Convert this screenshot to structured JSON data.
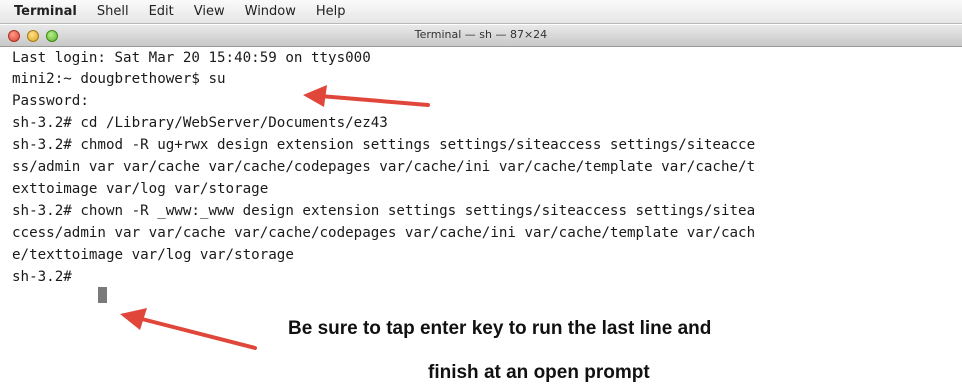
{
  "menubar": {
    "items": [
      "Terminal",
      "Shell",
      "Edit",
      "View",
      "Window",
      "Help"
    ]
  },
  "window": {
    "title": "Terminal — sh — 87×24"
  },
  "terminal": {
    "lines": [
      "Last login: Sat Mar 20 15:40:59 on ttys000",
      "mini2:~ dougbrethower$ su",
      "Password:",
      "sh-3.2# cd /Library/WebServer/Documents/ez43",
      "sh-3.2# chmod -R ug+rwx design extension settings settings/siteaccess settings/siteacce",
      "ss/admin var var/cache var/cache/codepages var/cache/ini var/cache/template var/cache/t",
      "exttoimage var/log var/storage",
      "sh-3.2# chown -R _www:_www design extension settings settings/siteaccess settings/sitea",
      "ccess/admin var var/cache var/cache/codepages var/cache/ini var/cache/template var/cach",
      "e/texttoimage var/log var/storage",
      "sh-3.2# "
    ]
  },
  "annotation": {
    "line1": "Be sure to tap enter key to run the last line and",
    "line2": "finish at an open  prompt",
    "arrow_color": "#e0473a"
  },
  "colors": {
    "text": "#1a1a1a",
    "cursor": "#7a7a7a"
  }
}
